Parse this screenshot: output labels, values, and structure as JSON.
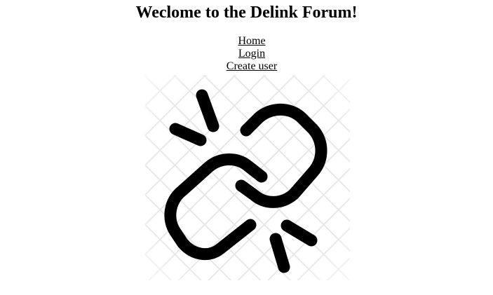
{
  "page": {
    "title": "Weclome to the Delink Forum!"
  },
  "nav": {
    "items": [
      {
        "label": "Home"
      },
      {
        "label": "Login"
      },
      {
        "label": "Create user"
      }
    ]
  },
  "logo": {
    "icon": "broken-link-icon",
    "color": "#000000",
    "background_pattern_color": "#e5e5e5"
  }
}
